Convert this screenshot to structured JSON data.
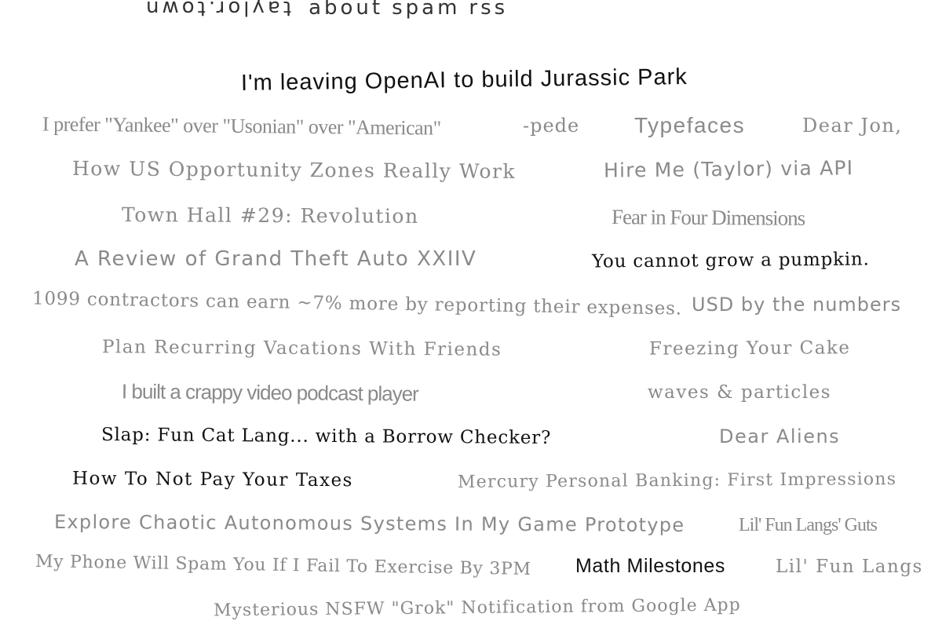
{
  "nav": {
    "brand": "taylor.town",
    "about": "about",
    "spam": "spam",
    "rss": "rss"
  },
  "posts": [
    "I'm leaving OpenAI to build Jurassic Park",
    "I prefer \"Yankee\" over \"Usonian\" over \"American\"",
    "-pede",
    "Typefaces",
    "Dear Jon,",
    "How US Opportunity Zones Really Work",
    "Hire Me (Taylor) via API",
    "Town Hall #29: Revolution",
    "Fear in Four Dimensions",
    "A Review of Grand Theft Auto XXIIV",
    "You cannot grow a pumpkin.",
    "1099 contractors can earn ~7% more by reporting their expenses.",
    "USD by the numbers",
    "Plan Recurring Vacations With Friends",
    "Freezing Your Cake",
    "I built a crappy video podcast player",
    "waves & particles",
    "Slap: Fun Cat Lang... with a Borrow Checker?",
    "Dear Aliens",
    "How To Not Pay Your Taxes",
    "Mercury Personal Banking: First Impressions",
    "Explore Chaotic Autonomous Systems In My Game Prototype",
    "Lil' Fun Langs' Guts",
    "My Phone Will Spam You If I Fail To Exercise By 3PM",
    "Math Milestones",
    "Lil' Fun Langs",
    "Mysterious NSFW \"Grok\" Notification from Google App"
  ]
}
